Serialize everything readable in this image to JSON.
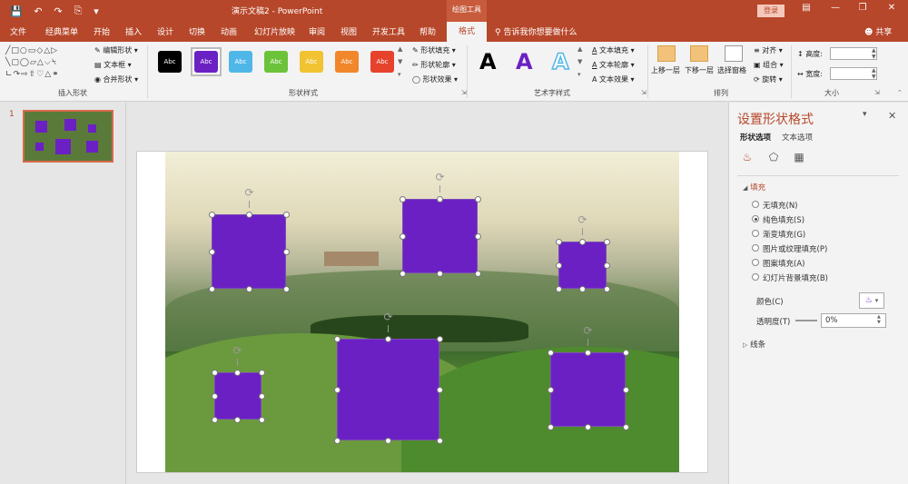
{
  "titlebar": {
    "title": "演示文稿2 - PowerPoint",
    "context_tool": "绘图工具",
    "login_label": "登录"
  },
  "tabs": [
    "文件",
    "经典菜单",
    "开始",
    "插入",
    "设计",
    "切换",
    "动画",
    "幻灯片放映",
    "审阅",
    "视图",
    "开发工具",
    "帮助",
    "格式"
  ],
  "active_tab": "格式",
  "tell_me": "告诉我你想要做什么",
  "share_label": "共享",
  "ribbon": {
    "insert_shapes": {
      "label": "插入形状",
      "edit_shape": "编辑形状",
      "text_box": "文本框",
      "merge_shapes": "合并形状"
    },
    "shape_styles": {
      "label": "形状样式",
      "swatch_text": "Abc",
      "swatch_colors": [
        "#000000",
        "#6b20c4",
        "#4fb7e8",
        "#6cc33a",
        "#f1c232",
        "#f1862a",
        "#e6422c"
      ],
      "shape_fill": "形状填充",
      "shape_outline": "形状轮廓",
      "shape_effects": "形状效果"
    },
    "wordart": {
      "label": "艺术字样式",
      "sample": "A",
      "text_fill": "文本填充",
      "text_outline": "文本轮廓",
      "text_effects": "文本效果"
    },
    "arrange": {
      "label": "排列",
      "bring_forward": "上移一层",
      "send_backward": "下移一层",
      "selection_pane": "选择窗格",
      "align": "对齐",
      "group": "组合",
      "rotate": "旋转"
    },
    "size": {
      "label": "大小",
      "height_label": "高度:",
      "width_label": "宽度:"
    }
  },
  "slides_panel": {
    "slide_number": "1"
  },
  "format_pane": {
    "title": "设置形状格式",
    "tab_shape": "形状选项",
    "tab_text": "文本选项",
    "fill_section": "填充",
    "fill_options": [
      {
        "label": "无填充(N)",
        "selected": false
      },
      {
        "label": "纯色填充(S)",
        "selected": true
      },
      {
        "label": "渐变填充(G)",
        "selected": false
      },
      {
        "label": "图片或纹理填充(P)",
        "selected": false
      },
      {
        "label": "图案填充(A)",
        "selected": false
      },
      {
        "label": "幻灯片背景填充(B)",
        "selected": false
      }
    ],
    "color_label": "颜色(C)",
    "transparency_label": "透明度(T)",
    "transparency_value": "0%",
    "line_section": "线条"
  },
  "colors": {
    "accent": "#b7472a",
    "shape_fill": "#6b20c4"
  }
}
